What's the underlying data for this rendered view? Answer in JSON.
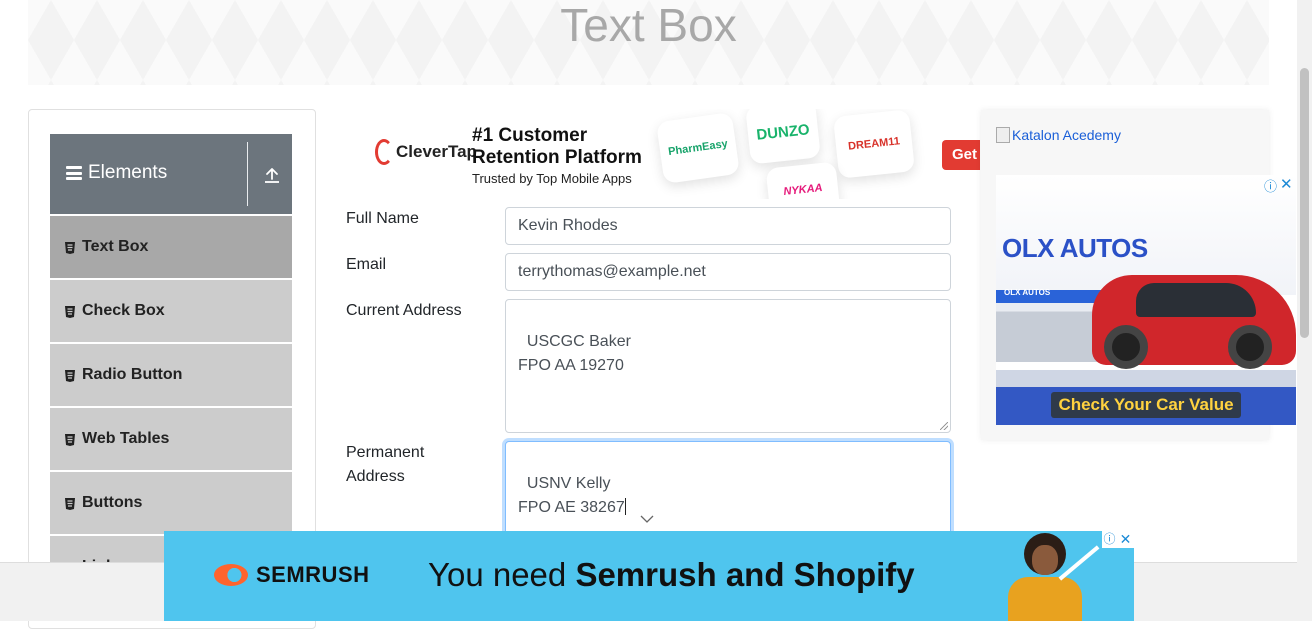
{
  "page": {
    "title": "Text Box"
  },
  "sidebar": {
    "group_title": "Elements",
    "items": [
      {
        "label": "Text Box",
        "active": true
      },
      {
        "label": "Check Box"
      },
      {
        "label": "Radio Button"
      },
      {
        "label": "Web Tables"
      },
      {
        "label": "Buttons"
      },
      {
        "label": "Links"
      }
    ]
  },
  "top_ad": {
    "brand": "CleverTap",
    "headline": "#1 Customer Retention Platform",
    "subline": "Trusted by Top Mobile Apps",
    "apps": [
      "PharmEasy",
      "DUNZO",
      "DREAM11",
      "NYKAA"
    ],
    "cta": "Get"
  },
  "form": {
    "full_name": {
      "label": "Full Name",
      "value": "Kevin Rhodes"
    },
    "email": {
      "label": "Email",
      "value": "terrythomas@example.net"
    },
    "current_address": {
      "label": "Current Address",
      "value": "USCGC Baker\nFPO AA 19270"
    },
    "permanent_address": {
      "label": "Permanent Address",
      "value": "USNV Kelly\nFPO AE 38267"
    }
  },
  "right_ads": {
    "katalon_alt": "Katalon Acedemy",
    "olx_title": "OLX AUTOS",
    "olx_cta": "Check Your Car Value",
    "olx_showroom": "OLX AUTOS",
    "info_symbol": "ⓘ",
    "close_symbol": "✕"
  },
  "bottom_ad": {
    "brand": "SEMRUSH",
    "copy_prefix": "You need ",
    "copy_bold": "Semrush and Shopify",
    "info_symbol": "ⓘ",
    "close_symbol": "✕"
  },
  "colors": {
    "sidebar_header": "#6c757d",
    "menu_item": "#cccccc",
    "menu_active": "#a8a8a8",
    "semrush_bg": "#4fc5ee",
    "focus_border": "#80bdff"
  }
}
